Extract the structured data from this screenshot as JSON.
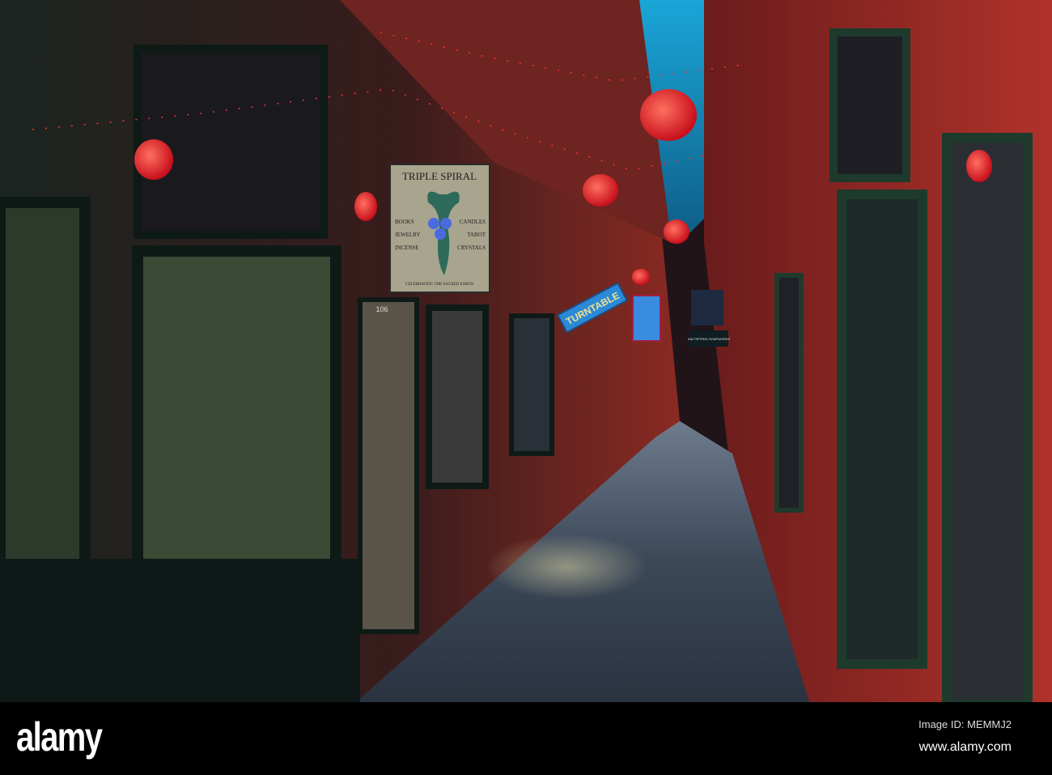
{
  "photo": {
    "signs": {
      "triple_spiral": {
        "title": "TRIPLE SPIRAL",
        "left_items": [
          "BOOKS",
          "JEWELRY",
          "INCENSE"
        ],
        "right_items": [
          "CANDLES",
          "TAROT",
          "CRYSTALS"
        ],
        "tagline": "CELEBRATING THE SACRED EARTH"
      },
      "turntable": "TURNTABLE",
      "door_number": "106",
      "saltspring": "SALTSPRING SOAPWORKS"
    },
    "colors": {
      "sky": "#1aa6d8",
      "brick": "#8a2a22",
      "lantern": "#e8202a",
      "floor": "#3a4656"
    }
  },
  "footer": {
    "brand": "alamy",
    "image_id": "Image ID: MEMMJ2",
    "url": "www.alamy.com"
  }
}
